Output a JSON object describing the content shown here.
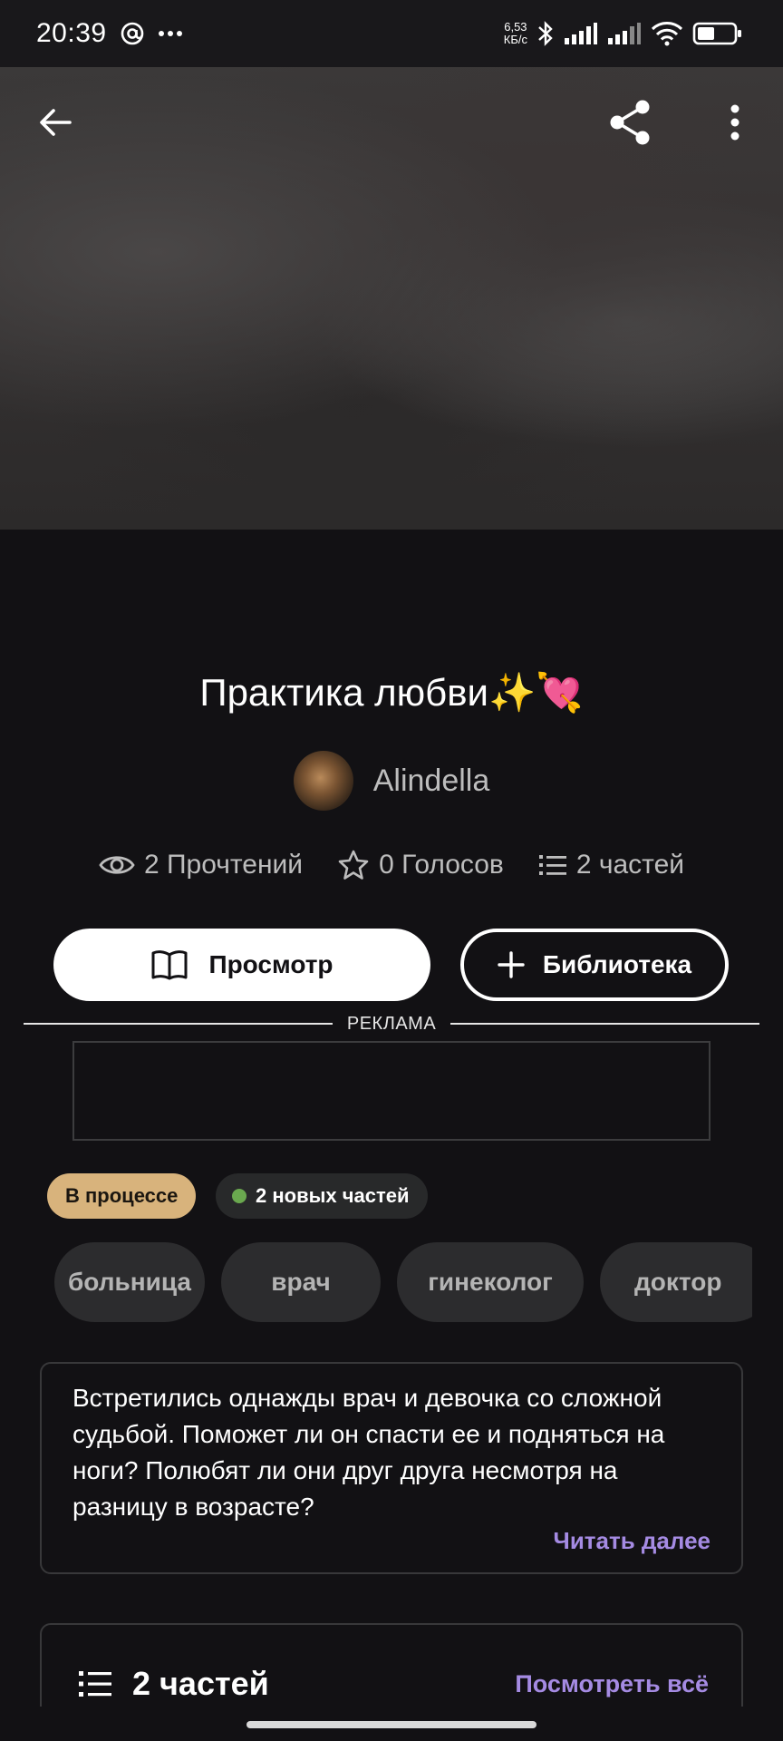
{
  "status_bar": {
    "time": "20:39",
    "speed_value": "6,53",
    "speed_unit": "КБ/с"
  },
  "story": {
    "title": "Практика любви✨💘",
    "author": "Alindella",
    "stats": {
      "reads": "2 Прочтений",
      "votes": "0 Голосов",
      "parts": "2 частей"
    }
  },
  "actions": {
    "view_label": "Просмотр",
    "library_label": "Библиотека"
  },
  "ad": {
    "label": "РЕКЛАМА"
  },
  "badges": {
    "status": "В процессе",
    "new_parts": "2 новых частей"
  },
  "tags": [
    "больница",
    "врач",
    "гинеколог",
    "доктор"
  ],
  "description": {
    "text": "Встретились однажды врач и девочка со сложной судьбой. Поможет ли он спасти ее и подняться на ноги? Полюбят ли они друг друга несмотря на разницу в возрасте?",
    "read_more": "Читать далее"
  },
  "parts_section": {
    "title": "2 частей",
    "see_all": "Посмотреть всё"
  },
  "colors": {
    "background": "#121114",
    "accent": "#a58be3",
    "status_badge": "#d8b37c",
    "new_dot": "#6aa84f"
  }
}
